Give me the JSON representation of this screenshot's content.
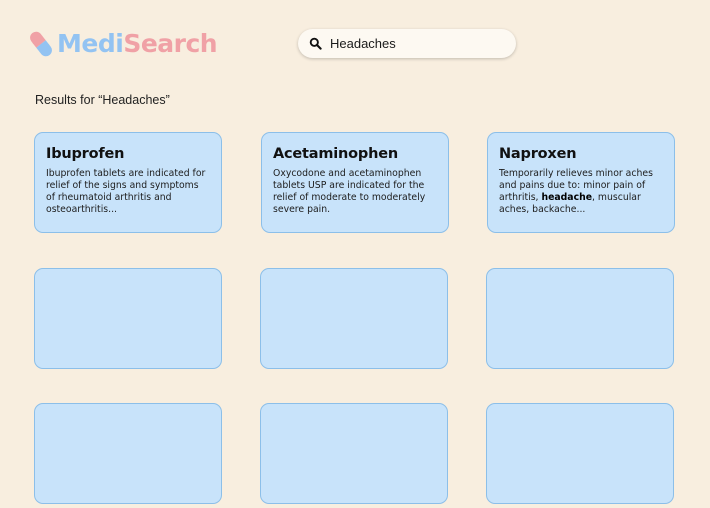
{
  "app": {
    "logo_part1": "Medi",
    "logo_part2": "Search",
    "logo_icon": "pill-icon"
  },
  "search": {
    "value": "Headaches",
    "placeholder": "Headaches",
    "icon": "search-icon"
  },
  "results": {
    "heading": "Results for “Headaches”",
    "cards": [
      {
        "title": "Ibuprofen",
        "description": "Ibuprofen tablets are indicated for relief of the signs and symptoms of rheumatoid arthritis and osteoarthritis..."
      },
      {
        "title": "Acetaminophen",
        "description": "Oxycodone and acetaminophen tablets USP are indicated for the relief of moderate to moderately severe pain."
      },
      {
        "title": "Naproxen",
        "description_before": "Temporarily relieves minor aches and pains due to: minor pain of arthritis, ",
        "description_highlight": "headache",
        "description_after": ", muscular aches,  backache..."
      }
    ]
  },
  "colors": {
    "background": "#f8eedf",
    "card_fill": "#c8e3fa",
    "card_border": "#8cbfe9",
    "logo_blue": "#93c3f2",
    "logo_pink": "#f0a1a6"
  }
}
